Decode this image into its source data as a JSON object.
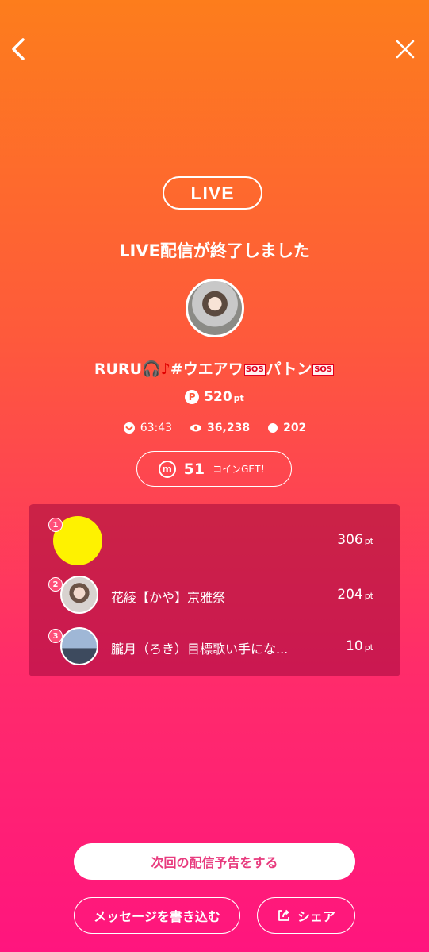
{
  "nav": {
    "back_icon": "chevron-left-icon",
    "close_icon": "close-icon"
  },
  "live_badge": "LIVE",
  "ended_message": "LIVE配信が終了しました",
  "stream": {
    "title_prefix": "RURU",
    "title_middle": "#ウエアワ",
    "title_after_sos": "パトン",
    "sos_label": "SOS",
    "points_value": "520",
    "points_unit": "pt",
    "points_icon_letter": "P"
  },
  "stats": {
    "duration": "63:43",
    "viewers": "36,238",
    "comments": "202"
  },
  "coins": {
    "icon_letter": "m",
    "count": "51",
    "label": "コインGET！"
  },
  "ranking": [
    {
      "rank": "1",
      "name": "",
      "points": "306",
      "unit": "pt"
    },
    {
      "rank": "2",
      "name": "花綾【かや】京雅祭",
      "points": "204",
      "unit": "pt"
    },
    {
      "rank": "3",
      "name": "朧月（ろき）目標歌い手にな...",
      "points": "10",
      "unit": "pt"
    }
  ],
  "buttons": {
    "schedule": "次回の配信予告をする",
    "message": "メッセージを書き込む",
    "share": "シェア"
  },
  "colors": {
    "gradient_top": "#fd7d1c",
    "gradient_bottom": "#ff157e",
    "accent_text": "#e83b7e"
  }
}
